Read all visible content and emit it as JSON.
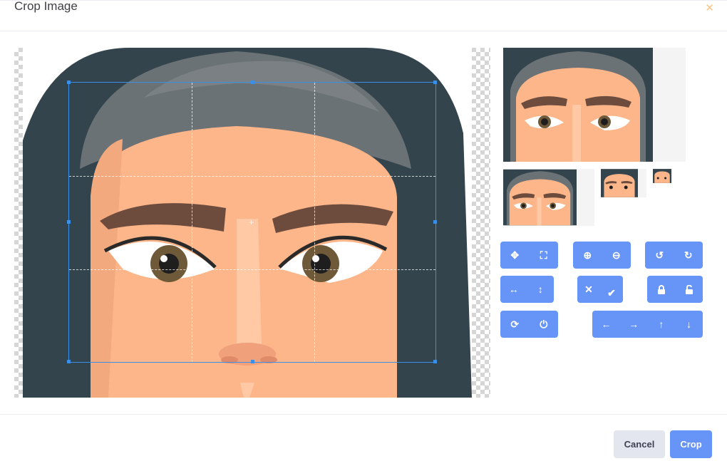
{
  "modal": {
    "title": "Crop Image",
    "close_icon": "close-icon"
  },
  "footer": {
    "cancel_label": "Cancel",
    "crop_label": "Crop"
  },
  "toolbar": {
    "groups": [
      {
        "name": "mode",
        "icons": [
          "move-icon",
          "crop-icon"
        ]
      },
      {
        "name": "zoom",
        "icons": [
          "zoom-in-icon",
          "zoom-out-icon"
        ]
      },
      {
        "name": "rotate",
        "icons": [
          "rotate-left-icon",
          "rotate-right-icon"
        ]
      },
      {
        "name": "flip",
        "icons": [
          "flip-horizontal-icon",
          "flip-vertical-icon"
        ]
      },
      {
        "name": "clear-commit",
        "icons": [
          "clear-icon",
          "check-icon"
        ]
      },
      {
        "name": "lock",
        "icons": [
          "lock-icon",
          "unlock-icon"
        ]
      },
      {
        "name": "reset-destroy",
        "icons": [
          "refresh-icon",
          "power-icon"
        ]
      },
      {
        "name": "move-arrows",
        "icons": [
          "arrow-left-icon",
          "arrow-right-icon",
          "arrow-up-icon",
          "arrow-down-icon"
        ]
      }
    ]
  },
  "colors": {
    "accent": "#6794f7",
    "crop_border": "#3a8fe8",
    "skin": "#fdb68a",
    "hijab_dark": "#33444d",
    "hijab_light": "#6b7275"
  }
}
